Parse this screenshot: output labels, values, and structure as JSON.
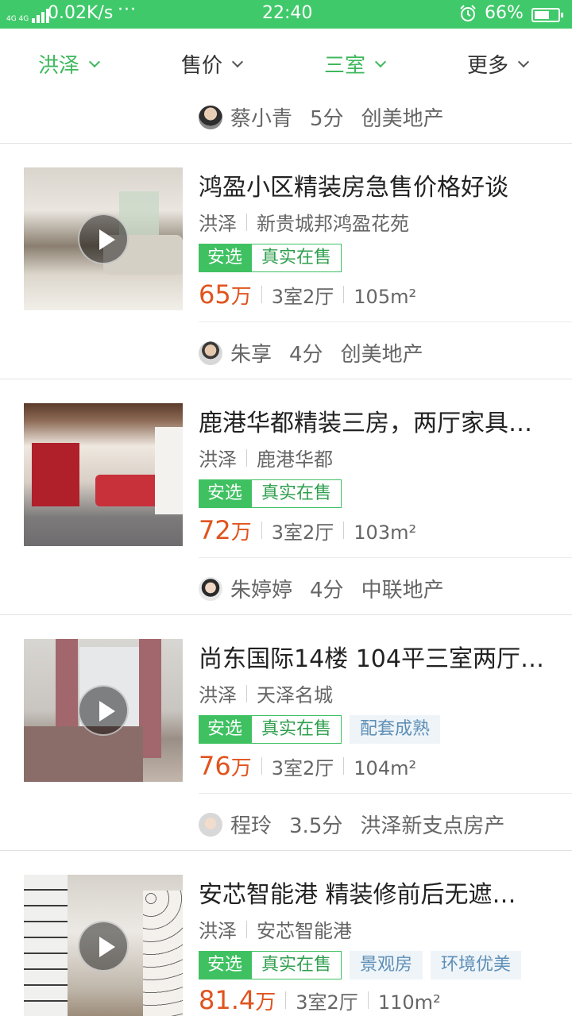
{
  "status": {
    "network": "4G 4G",
    "speed": "0.02K/s",
    "dots": "···",
    "time": "22:40",
    "battery": "66%",
    "battery_level": 0.66,
    "accent": "#3fc96a"
  },
  "filters": [
    {
      "label": "洪泽",
      "active": true
    },
    {
      "label": "售价",
      "active": false
    },
    {
      "label": "三室",
      "active": true
    },
    {
      "label": "更多",
      "active": false
    }
  ],
  "top_agent": {
    "name": "蔡小青",
    "score": "5分",
    "company": "创美地产"
  },
  "listings": [
    {
      "title": "鸿盈小区精装房急售价格好谈",
      "district": "洪泽",
      "community": "新贵城邦鸿盈花苑",
      "tags": [
        "安选",
        "真实在售"
      ],
      "extra_tags": [],
      "price": "65",
      "price_unit": "万",
      "layout": "3室2厅",
      "area": "105m²",
      "has_video": true,
      "agent": {
        "name": "朱享",
        "score": "4分",
        "company": "创美地产"
      }
    },
    {
      "title": "鹿港华都精装三房，两厅家具…",
      "district": "洪泽",
      "community": "鹿港华都",
      "tags": [
        "安选",
        "真实在售"
      ],
      "extra_tags": [],
      "price": "72",
      "price_unit": "万",
      "layout": "3室2厅",
      "area": "103m²",
      "has_video": false,
      "agent": {
        "name": "朱婷婷",
        "score": "4分",
        "company": "中联地产"
      }
    },
    {
      "title": "尚东国际14楼 104平三室两厅…",
      "district": "洪泽",
      "community": "天泽名城",
      "tags": [
        "安选",
        "真实在售"
      ],
      "extra_tags": [
        "配套成熟"
      ],
      "price": "76",
      "price_unit": "万",
      "layout": "3室2厅",
      "area": "104m²",
      "has_video": true,
      "agent": {
        "name": "程玲",
        "score": "3.5分",
        "company": "洪泽新支点房产"
      }
    },
    {
      "title": "安芯智能港 精装修前后无遮…",
      "district": "洪泽",
      "community": "安芯智能港",
      "tags": [
        "安选",
        "真实在售"
      ],
      "extra_tags": [
        "景观房",
        "环境优美"
      ],
      "price": "81.4",
      "price_unit": "万",
      "layout": "3室2厅",
      "area": "110m²",
      "has_video": true,
      "agent": null
    }
  ]
}
